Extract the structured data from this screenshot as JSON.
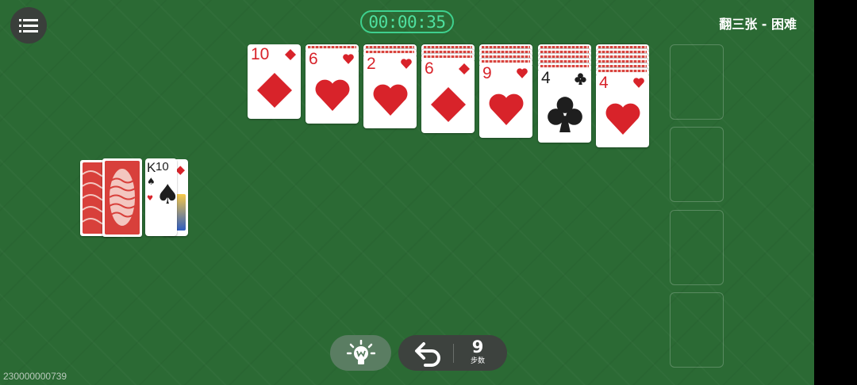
{
  "header": {
    "timer": "00:00:35",
    "mode": "翻三张 - 困难"
  },
  "tableau": [
    {
      "rank": "10",
      "suit": "diamond",
      "color": "red",
      "hidden": 0
    },
    {
      "rank": "6",
      "suit": "heart",
      "color": "red",
      "hidden": 1
    },
    {
      "rank": "2",
      "suit": "heart",
      "color": "red",
      "hidden": 2
    },
    {
      "rank": "6",
      "suit": "diamond",
      "color": "red",
      "hidden": 3
    },
    {
      "rank": "9",
      "suit": "heart",
      "color": "red",
      "hidden": 4
    },
    {
      "rank": "4",
      "suit": "club",
      "color": "black",
      "hidden": 5
    },
    {
      "rank": "4",
      "suit": "heart",
      "color": "red",
      "hidden": 6
    }
  ],
  "waste": {
    "top_rank": "K",
    "top_suit": "spade",
    "under_rank": "10",
    "under_suit": "diamond"
  },
  "toolbar": {
    "moves": "9",
    "moves_label": "步数"
  },
  "footer": {
    "game_id": "230000000739"
  },
  "colors": {
    "felt": "#2b6a34",
    "red": "#d8232a",
    "timer": "#3ed08e"
  }
}
